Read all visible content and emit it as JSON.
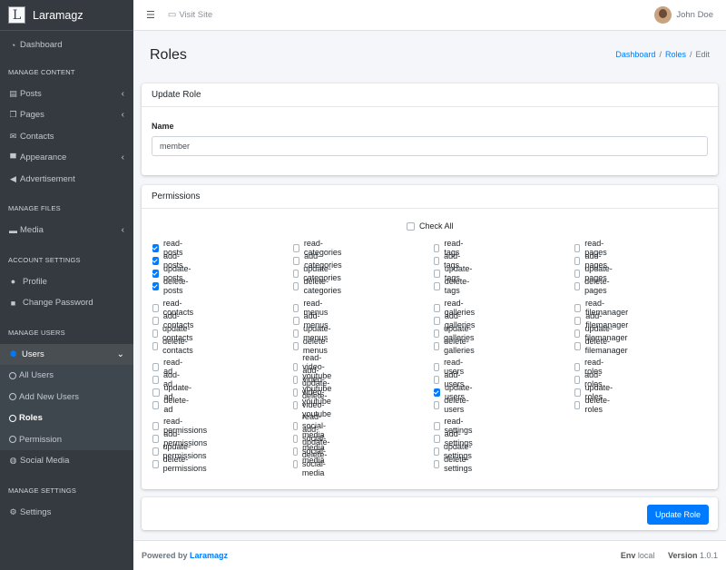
{
  "brand": {
    "logo_letter": "L",
    "name": "Laramagz"
  },
  "sidebar": {
    "dashboard": "Dashboard",
    "sections": [
      {
        "header": "MANAGE CONTENT",
        "items": [
          "Posts",
          "Pages",
          "Contacts",
          "Appearance",
          "Advertisement"
        ]
      },
      {
        "header": "MANAGE FILES",
        "items": [
          "Media"
        ]
      },
      {
        "header": "ACCOUNT SETTINGS",
        "items": [
          "Profile",
          "Change Password"
        ]
      },
      {
        "header": "MANAGE USERS",
        "items": [
          "Users"
        ]
      }
    ],
    "users_sub": [
      "All Users",
      "Add New Users",
      "Roles",
      "Permission"
    ],
    "social_media": "Social Media",
    "settings_header": "MANAGE SETTINGS",
    "settings": "Settings"
  },
  "topbar": {
    "visit_site": "Visit Site",
    "user_name": "John Doe"
  },
  "page": {
    "title": "Roles",
    "breadcrumb": [
      "Dashboard",
      "Roles",
      "Edit"
    ]
  },
  "update_role": {
    "header": "Update Role",
    "name_label": "Name",
    "name_value": "member"
  },
  "permissions": {
    "header": "Permissions",
    "check_all": "Check All",
    "groups": [
      [
        [
          "read-posts",
          "add-posts",
          "update-posts",
          "delete-posts"
        ],
        [
          "read-categories",
          "add-categories",
          "update-categories",
          "delete-categories"
        ],
        [
          "read-tags",
          "add-tags",
          "update-tags",
          "delete-tags"
        ],
        [
          "read-pages",
          "add-pages",
          "update-pages",
          "delete-pages"
        ]
      ],
      [
        [
          "read-contacts",
          "add-contacts",
          "update-contacts",
          "delete-contacts"
        ],
        [
          "read-menus",
          "add-menus",
          "update-menus",
          "delete-menus"
        ],
        [
          "read-galleries",
          "add-galleries",
          "update-galleries",
          "delete-galleries"
        ],
        [
          "read-filemanager",
          "add-filemanager",
          "update-filemanager",
          "delete-filemanager"
        ]
      ],
      [
        [
          "read-ad",
          "add-ad",
          "update-ad",
          "delete-ad"
        ],
        [
          "read-video-youtube",
          "add-video-youtube",
          "update-video-youtube",
          "delete-video-youtube"
        ],
        [
          "read-users",
          "add-users",
          "update-users",
          "delete-users"
        ],
        [
          "read-roles",
          "add-roles",
          "update-roles",
          "delete-roles"
        ]
      ],
      [
        [
          "read-permissions",
          "add-permissions",
          "update-permissions",
          "delete-permissions"
        ],
        [
          "read-social-media",
          "add-social-media",
          "update-social-media",
          "delete-social-media"
        ],
        [
          "read-settings",
          "add-settings",
          "update-settings",
          "delete-settings"
        ]
      ]
    ],
    "checked": [
      "read-posts",
      "add-posts",
      "update-posts",
      "delete-posts",
      "update-users"
    ]
  },
  "actions": {
    "update_button": "Update Role"
  },
  "footer": {
    "powered_by": "Powered by",
    "brand": "Laramagz",
    "env_label": "Env",
    "env_value": "local",
    "version_label": "Version",
    "version_value": "1.0.1"
  },
  "colors": {
    "primary": "#007bff",
    "sidebar_bg": "#343a40"
  }
}
